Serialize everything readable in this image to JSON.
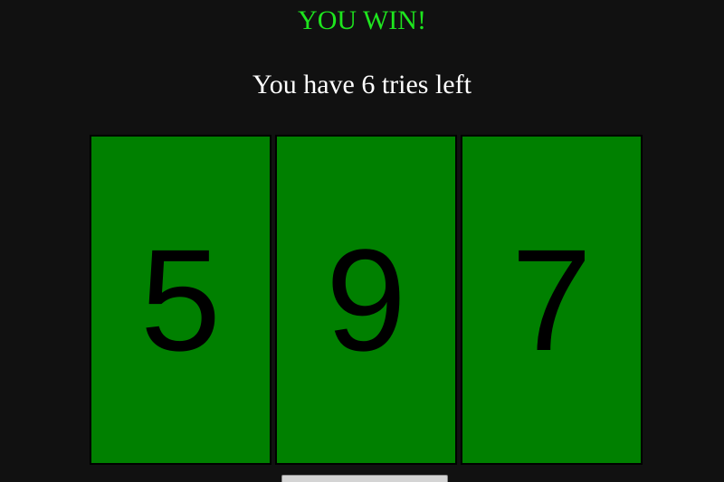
{
  "status": {
    "title": "YOU WIN!",
    "tries_text": "You have 6 tries left"
  },
  "digits": [
    {
      "value": "5"
    },
    {
      "value": "9"
    },
    {
      "value": "7"
    }
  ],
  "colors": {
    "background": "#111111",
    "win_text": "#1ee51e",
    "card": "#008000",
    "text": "#ffffff"
  }
}
